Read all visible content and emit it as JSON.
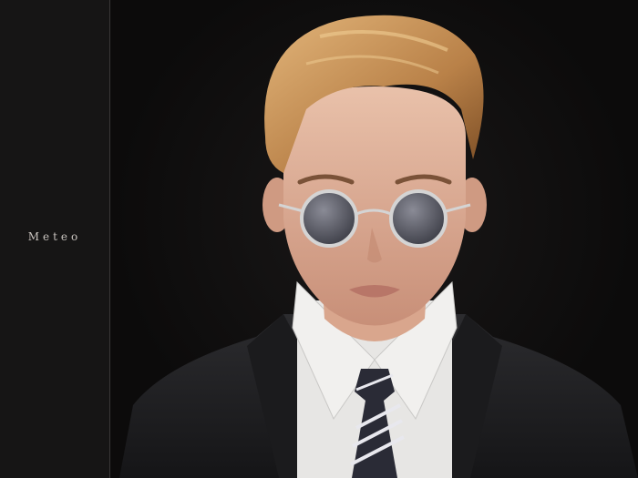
{
  "brand": {
    "name": "Meteo"
  },
  "colors": {
    "side_panel": "#161515",
    "background": "#0c0b0b",
    "hair": "#c99a5b",
    "skin": "#e2b49c",
    "suit": "#222224",
    "shirt": "#e7e6e4",
    "lens": "#6e6f79",
    "frame": "#d4d4d4"
  },
  "illustration": {
    "subject": "portrait",
    "accessories": [
      "round-sunglasses-icon",
      "striped-tie-icon"
    ]
  }
}
